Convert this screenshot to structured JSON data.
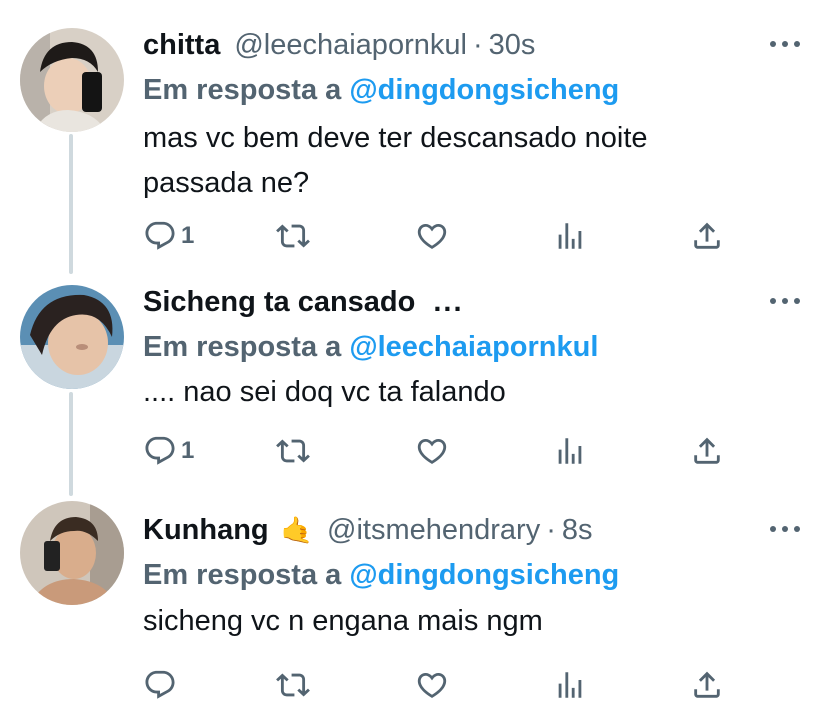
{
  "colors": {
    "accent": "#1d9bf0",
    "secondary_text": "#536471",
    "primary_text": "#0f1419",
    "thread_line": "#cfd9de"
  },
  "replies": [
    {
      "display_name": "chitta",
      "handle": "@leechaiapornkul",
      "separator": "·",
      "time": "30s",
      "replying_prefix": "Em resposta a",
      "replying_to": "@dingdongsicheng",
      "text_lines": [
        "mas vc bem deve ter descansado noite",
        "passada ne?"
      ],
      "reply_count": "1",
      "icons": [
        "reply-icon",
        "retweet-icon",
        "like-icon",
        "analytics-icon",
        "share-icon"
      ]
    },
    {
      "display_name": "Sicheng ta cansado",
      "truncation": "...",
      "replying_prefix": "Em resposta a",
      "replying_to": "@leechaiapornkul",
      "text_lines": [
        ".... nao sei doq vc ta falando"
      ],
      "reply_count": "1",
      "icons": [
        "reply-icon",
        "retweet-icon",
        "like-icon",
        "analytics-icon",
        "share-icon"
      ]
    },
    {
      "display_name": "Kunhang",
      "name_emoji": "🤙",
      "handle": "@itsmehendrary",
      "separator": "·",
      "time": "8s",
      "replying_prefix": "Em resposta a",
      "replying_to": "@dingdongsicheng",
      "text_lines": [
        "sicheng vc n engana mais ngm"
      ],
      "reply_count": "",
      "icons": [
        "reply-icon",
        "retweet-icon",
        "like-icon",
        "analytics-icon",
        "share-icon"
      ]
    }
  ]
}
